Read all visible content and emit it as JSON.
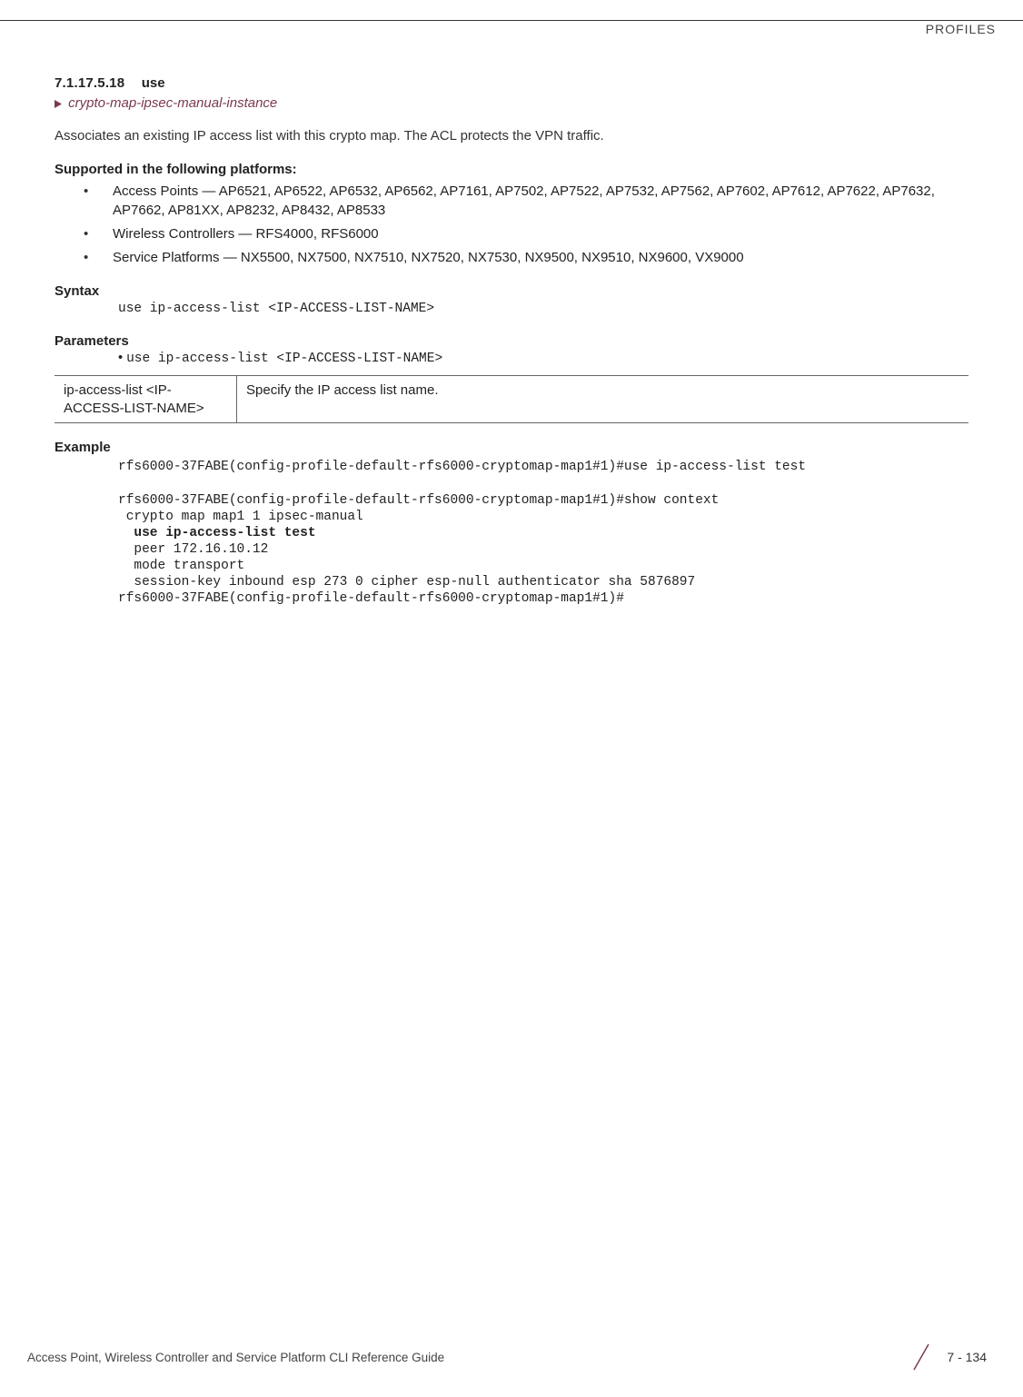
{
  "header": {
    "right": "PROFILES"
  },
  "section": {
    "number": "7.1.17.5.18",
    "title": "use",
    "crumb": "crypto-map-ipsec-manual-instance",
    "intro": "Associates an existing IP access list with this crypto map. The ACL protects the VPN traffic."
  },
  "supported": {
    "heading": "Supported in the following platforms:",
    "items": [
      "Access Points — AP6521, AP6522, AP6532, AP6562, AP7161, AP7502, AP7522, AP7532, AP7562, AP7602, AP7612, AP7622, AP7632, AP7662, AP81XX, AP8232, AP8432, AP8533",
      "Wireless Controllers — RFS4000, RFS6000",
      "Service Platforms — NX5500, NX7500, NX7510, NX7520, NX7530, NX9500, NX9510, NX9600, VX9000"
    ]
  },
  "syntax": {
    "heading": "Syntax",
    "code": "use ip-access-list <IP-ACCESS-LIST-NAME>"
  },
  "parameters": {
    "heading": "Parameters",
    "bullet": "use ip-access-list <IP-ACCESS-LIST-NAME>",
    "table": {
      "key": "ip-access-list <IP-ACCESS-LIST-NAME>",
      "desc": "Specify the IP access list name."
    }
  },
  "example": {
    "heading": "Example",
    "line1": "rfs6000-37FABE(config-profile-default-rfs6000-cryptomap-map1#1)#use ip-access-list test",
    "line2": "rfs6000-37FABE(config-profile-default-rfs6000-cryptomap-map1#1)#show context",
    "line3": " crypto map map1 1 ipsec-manual",
    "line4_bold": "  use ip-access-list test",
    "line5": "  peer 172.16.10.12",
    "line6": "  mode transport",
    "line7": "  session-key inbound esp 273 0 cipher esp-null authenticator sha 5876897",
    "line8": "rfs6000-37FABE(config-profile-default-rfs6000-cryptomap-map1#1)#"
  },
  "footer": {
    "text": "Access Point, Wireless Controller and Service Platform CLI Reference Guide",
    "page": "7 - 134"
  }
}
